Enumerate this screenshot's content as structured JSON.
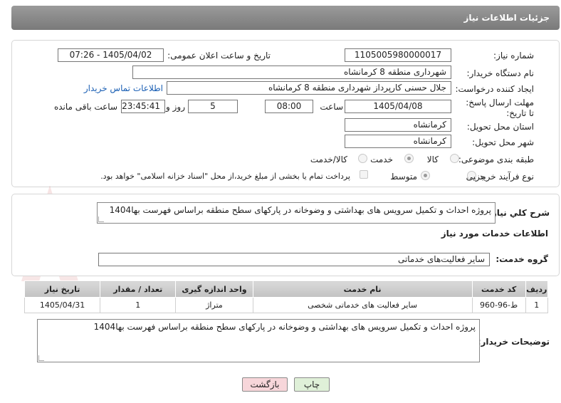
{
  "header": {
    "title": "جزئیات اطلاعات نیاز"
  },
  "labels": {
    "need_number": "شماره نیاز:",
    "announce_datetime": "تاریخ و ساعت اعلان عمومی:",
    "buyer_org": "نام دستگاه خریدار:",
    "requester": "ایجاد کننده درخواست:",
    "buyer_contact": "اطلاعات تماس خریدار",
    "reply_deadline": "مهلت ارسال پاسخ: تا تاریخ:",
    "time": "ساعت",
    "day_and": "روز و",
    "remaining_time": "ساعت باقی مانده",
    "delivery_province": "استان محل تحویل:",
    "delivery_city": "شهر محل تحویل:",
    "category": "طبقه بندی موضوعی:",
    "process_type": "نوع فرآیند خرید :",
    "need_summary": "شرح کلي نياز:",
    "services_info": "اطلاعات خدمات مورد نیاز",
    "service_group": "گروه خدمت:",
    "buyer_notes": "توضیحات خریدار:"
  },
  "values": {
    "need_number": "1105005980000017",
    "announce_datetime": "1405/04/02 - 07:26",
    "buyer_org": "شهرداری منطقه 8 کرمانشاه",
    "requester": "جلال حسنی کارپرداز شهرداری منطقه 8 کرمانشاه",
    "deadline_date": "1405/04/08",
    "deadline_time": "08:00",
    "days": "5",
    "remaining": "23:45:41",
    "province": "کرمانشاه",
    "city": "کرمانشاه",
    "need_summary": "پروژه احداث و تکمیل سرویس های بهداشتی و وضوخانه در پارکهای سطح منطقه براساس فهرست بها1404",
    "service_group": "سایر فعالیت‌های خدماتی",
    "buyer_notes": "پروژه احداث و تکمیل سرویس های بهداشتی و وضوخانه در پارکهای سطح منطقه براساس فهرست بها1404"
  },
  "category_options": [
    {
      "label": "کالا",
      "selected": false
    },
    {
      "label": "خدمت",
      "selected": true
    },
    {
      "label": "کالا/خدمت",
      "selected": false
    }
  ],
  "process_options": [
    {
      "label": "جزیی",
      "selected": false
    },
    {
      "label": "متوسط",
      "selected": true
    }
  ],
  "payment_note": "پرداخت تمام یا بخشی از مبلغ خرید،از محل \"اسناد خزانه اسلامی\" خواهد بود.",
  "table": {
    "headers": [
      "ردیف",
      "کد خدمت",
      "نام خدمت",
      "واحد اندازه گیری",
      "تعداد / مقدار",
      "تاریخ نیاز"
    ],
    "rows": [
      [
        "1",
        "ط-96-960",
        "سایر فعالیت های خدماتی شخصی",
        "متراژ",
        "1",
        "1405/04/31"
      ]
    ]
  },
  "buttons": {
    "print": "چاپ",
    "back": "بازگشت"
  },
  "watermark": {
    "text": "AriaTender.net"
  },
  "colors": {
    "header_bg": "#8a8a8a",
    "link": "#1a5fb4",
    "back_btn_bg": "#f7d6da",
    "print_btn_bg": "#dff0d8"
  }
}
